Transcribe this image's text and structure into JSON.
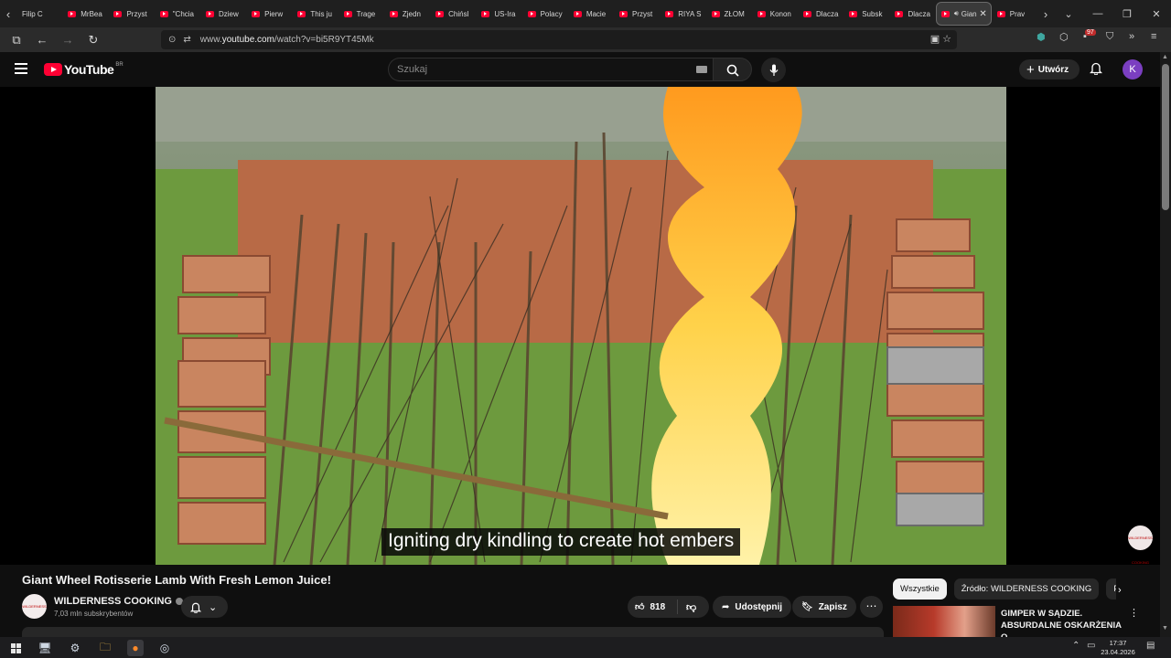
{
  "browser": {
    "tabs": [
      {
        "label": "Filip C",
        "type": "plain"
      },
      {
        "label": "MrBea",
        "type": "yt"
      },
      {
        "label": "Przyst",
        "type": "yt"
      },
      {
        "label": "\"Chcia",
        "type": "yt"
      },
      {
        "label": "Dziew",
        "type": "yt"
      },
      {
        "label": "Pierw",
        "type": "yt"
      },
      {
        "label": "This ju",
        "type": "yt"
      },
      {
        "label": "Trage",
        "type": "yt"
      },
      {
        "label": "Zjedn",
        "type": "yt"
      },
      {
        "label": "Chińsl",
        "type": "yt"
      },
      {
        "label": "US-Ira",
        "type": "yt"
      },
      {
        "label": "Polacy",
        "type": "yt"
      },
      {
        "label": "Macie",
        "type": "yt"
      },
      {
        "label": "Przyst",
        "type": "yt"
      },
      {
        "label": "RIYA S",
        "type": "yt"
      },
      {
        "label": "ZŁOM",
        "type": "yt"
      },
      {
        "label": "Konon",
        "type": "yt"
      },
      {
        "label": "Dlacza",
        "type": "yt"
      },
      {
        "label": "Subsk",
        "type": "yt"
      },
      {
        "label": "Dlacza",
        "type": "yt"
      },
      {
        "label": "Gian",
        "type": "active"
      },
      {
        "label": "Prav",
        "type": "yt"
      }
    ],
    "url_prefix": "www.",
    "url_domain": "youtube.com",
    "url_path": "/watch?v=bi5R9YT45Mk",
    "extension_badge": "97"
  },
  "masthead": {
    "logo_text": "YouTube",
    "country_code": "BR",
    "search_placeholder": "Szukaj",
    "create_label": "Utwórz",
    "avatar_letter": "K"
  },
  "player": {
    "caption": "Igniting dry kindling to create hot embers",
    "watermark_text": "WILDERNESS COOKING"
  },
  "video": {
    "title": "Giant Wheel Rotisserie Lamb With Fresh Lemon Juice!",
    "channel_name": "WILDERNESS COOKING",
    "subscribers": "7,03 mln subskrybentów",
    "avatar_text": "WILDERNESS COOKING",
    "likes": "818",
    "share_label": "Udostępnij",
    "save_label": "Zapisz"
  },
  "sidebar": {
    "chips": [
      {
        "label": "Wszystkie",
        "selected": true
      },
      {
        "label": "Źródło: WILDERNESS COOKING",
        "selected": false
      },
      {
        "label": "Po",
        "selected": false
      }
    ],
    "recommendation": {
      "title": "GIMPER W SĄDZIE. ABSURDALNE OSKARŻENIA O..."
    }
  },
  "taskbar": {
    "time": "17:37",
    "date": "23.04.2026"
  },
  "colors": {
    "background": "#0f0f0f",
    "youtube_red": "#ff0033",
    "avatar": "#7b3fc1",
    "pill": "#272727"
  },
  "icons": {
    "menu": "hamburger-menu-icon",
    "search": "search-icon",
    "mic": "microphone-icon",
    "bell": "bell-icon",
    "like": "thumbs-up-icon",
    "dislike": "thumbs-down-icon",
    "share": "share-icon",
    "save": "bookmark-icon"
  }
}
